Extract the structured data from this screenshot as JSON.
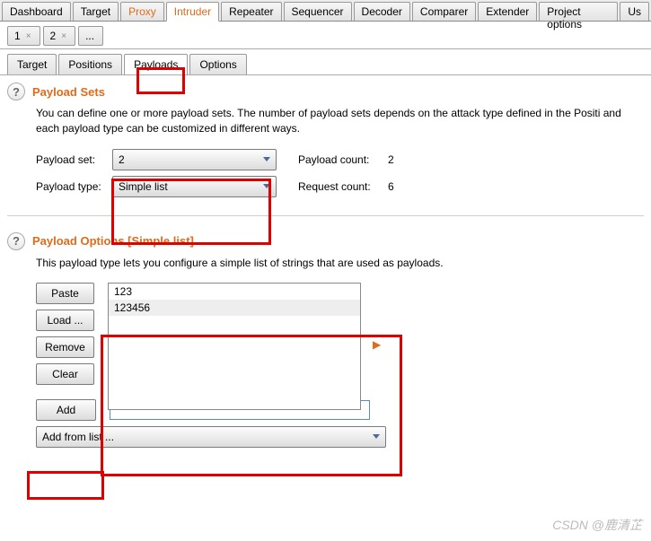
{
  "mainTabs": {
    "t0": "Dashboard",
    "t1": "Target",
    "t2": "Proxy",
    "t3": "Intruder",
    "t4": "Repeater",
    "t5": "Sequencer",
    "t6": "Decoder",
    "t7": "Comparer",
    "t8": "Extender",
    "t9": "Project options",
    "t10": "Us"
  },
  "attackTabs": {
    "a0": "1",
    "a1": "2",
    "a2": "..."
  },
  "innerTabs": {
    "i0": "Target",
    "i1": "Positions",
    "i2": "Payloads",
    "i3": "Options"
  },
  "sets": {
    "title": "Payload Sets",
    "desc": "You can define one or more payload sets. The number of payload sets depends on the attack type defined in the Positi and each payload type can be customized in different ways.",
    "row1label": "Payload set:",
    "row1val": "2",
    "row1stat": "Payload count:",
    "row1statval": "2",
    "row2label": "Payload type:",
    "row2val": "Simple list",
    "row2stat": "Request count:",
    "row2statval": "6"
  },
  "opts": {
    "title": "Payload Options [Simple list]",
    "desc": "This payload type lets you configure a simple list of strings that are used as payloads.",
    "btnPaste": "Paste",
    "btnLoad": "Load ...",
    "btnRemove": "Remove",
    "btnClear": "Clear",
    "btnAdd": "Add",
    "item0": "123",
    "item1": "123456",
    "addFrom": "Add from list ..."
  },
  "watermark": "CSDN @鹿清芷"
}
